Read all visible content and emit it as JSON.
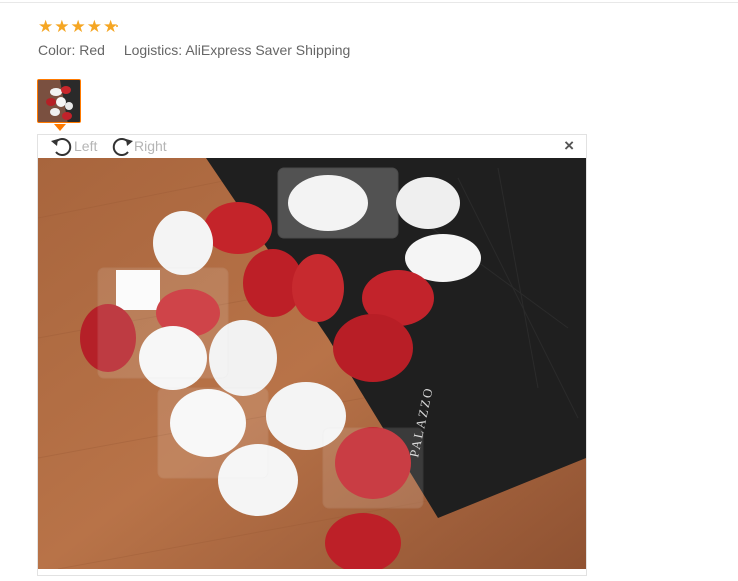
{
  "review": {
    "rating_value": 5,
    "rating_max": 5,
    "stars": [
      "★",
      "★",
      "★",
      "★",
      "★"
    ],
    "color_label": "Color:",
    "color_value": "Red",
    "logistics_label": "Logistics:",
    "logistics_value": "AliExpress Saver Shipping"
  },
  "viewer": {
    "rotate_left_label": "Left",
    "rotate_right_label": "Right",
    "close_label": "×",
    "photo_box_text": "PALAZZO"
  },
  "colors": {
    "star": "#f5a623",
    "accent": "#ff7a00",
    "text": "#666666",
    "muted": "#b5b5b5"
  }
}
